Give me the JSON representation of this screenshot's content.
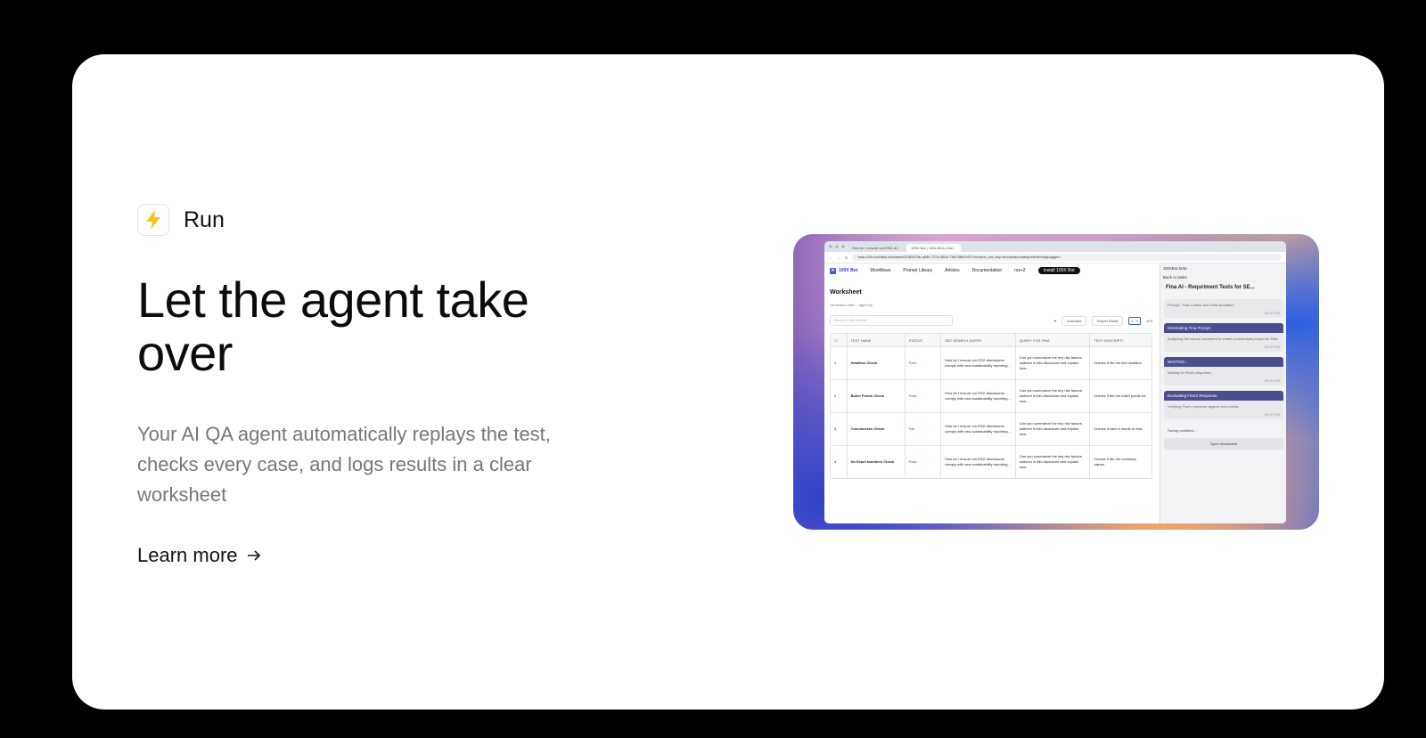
{
  "tag": {
    "icon": "lightning-bolt-icon",
    "label": "Run"
  },
  "headline": "Let the agent take over",
  "description": "Your AI QA agent automatically replays the test, checks every case, and logs results in a clear worksheet",
  "cta": {
    "label": "Learn more",
    "icon": "arrow-right-icon"
  },
  "preview": {
    "tabs": [
      "How do I ensure our ESG di...",
      "100X Bot | 100x All-in-One..."
    ],
    "url": "beta.100x.bot/task-worksheet/0189579b-a080-727e-861d-798758b7bf71?chrome_ext_key=dhcaninbomebdpn/ehfkmidbp/pjgnm",
    "nav": {
      "brand": "100X Bot",
      "items": [
        "Workflows",
        "Prompt Library",
        "Articles",
        "Documentation"
      ],
      "user": "rss+2",
      "install": "Install 100X Bot"
    },
    "worksheet": {
      "title": "Worksheet",
      "subtitle": "Generated with ... agent by",
      "search_placeholder": "Search in the results",
      "columns_btn": "Columns",
      "export_btn": "Export Sheet",
      "pager": "1 - 5",
      "pager_of": "of 5",
      "headers": [
        "TEST NAME",
        "STATUS",
        "SEC SEARCH QUERY",
        "QUERY FOR FINA",
        "TEST DESCRIPTI"
      ],
      "rows": [
        {
          "n": "1",
          "name": "Headline Check",
          "status": "Pass",
          "q1": "How do I ensure our ESG disclosures comply with new sustainability reporting...",
          "q2": "Can you summarize the key risk factors outlined in this disclosure and explain how...",
          "d": "Checks if the res line headline."
        },
        {
          "n": "2",
          "name": "Bullet Points Check",
          "status": "Pass",
          "q1": "How do I ensure our ESG disclosures comply with new sustainability reporting...",
          "q2": "Can you summarize the key risk factors outlined in this disclosure and explain how...",
          "d": "Checks if the res bullet points lot."
        },
        {
          "n": "3",
          "name": "Conciseness Check",
          "status": "Fail",
          "q1": "How do I ensure our ESG disclosures comply with new sustainability reporting...",
          "q2": "Can you summarize the key risk factors outlined in this disclosure and explain how...",
          "d": "Checks if each b words or less."
        },
        {
          "n": "4",
          "name": "No Exact Numbers Check",
          "status": "Pass",
          "q1": "How do I ensure our ESG disclosures comply with new sustainability reporting...",
          "q2": "Can you summarize the key risk factors outlined in this disclosure and explain how...",
          "d": "Checks if the res monetary values."
        }
      ]
    },
    "sidepanel": {
      "app": "100xBot.beta",
      "back": "Back to tasks",
      "title": "Fina AI - Requriment Tests for SE...",
      "top_note": "Prompt - Fina content and bullet quotation",
      "top_time": "05:40 PM",
      "cards": [
        {
          "title": "Generating Fina Prompt",
          "body": "Analyzing the source document to create a contextual prompt for Fina.",
          "time": "05:40 PM"
        },
        {
          "title": "WAITING...",
          "body": "Waiting for Fina's response...",
          "time": "05:50 PM"
        },
        {
          "title": "Evaluating Fina's Response",
          "body": "Verifying Fina's response against test criteria.",
          "time": "05:50 PM"
        }
      ],
      "saving": "Saving variables...",
      "open_ws": "Open Worksheet"
    }
  }
}
